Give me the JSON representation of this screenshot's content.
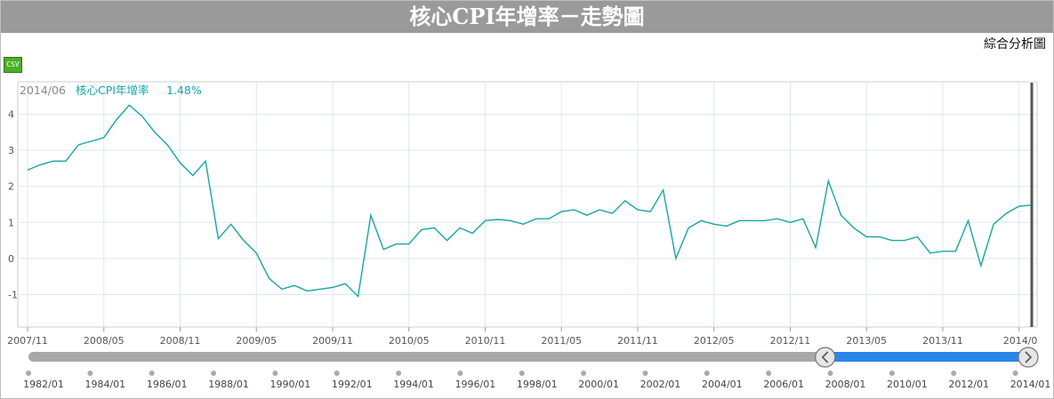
{
  "title": "核心CPI年增率－走勢圖",
  "analysis_link": "綜合分析圖",
  "csv_button": "CSV",
  "legend": {
    "date": "2014/06",
    "series_label": "核心CPI年增率",
    "value": "1.48%"
  },
  "colors": {
    "line": "#17a5a5",
    "navigator_fill": "#2a86e8",
    "navigator_track": "#a8a8a8",
    "title_bg": "#9a9a9a"
  },
  "chart_data": {
    "type": "line",
    "series": [
      {
        "name": "核心CPI年增率",
        "values": [
          2.45,
          2.6,
          2.7,
          2.7,
          3.15,
          3.25,
          3.35,
          3.85,
          4.25,
          3.95,
          3.5,
          3.15,
          2.65,
          2.3,
          2.7,
          0.55,
          0.95,
          0.5,
          0.15,
          -0.55,
          -0.85,
          -0.75,
          -0.9,
          -0.85,
          -0.8,
          -0.7,
          -1.05,
          1.2,
          0.25,
          0.4,
          0.4,
          0.8,
          0.85,
          0.5,
          0.85,
          0.7,
          1.05,
          1.08,
          1.05,
          0.95,
          1.1,
          1.1,
          1.3,
          1.35,
          1.2,
          1.35,
          1.25,
          1.6,
          1.35,
          1.3,
          1.9,
          0.0,
          0.85,
          1.05,
          0.95,
          0.9,
          1.05,
          1.05,
          1.05,
          1.1,
          1.0,
          1.1,
          0.3,
          2.15,
          1.2,
          0.85,
          0.6,
          0.6,
          0.5,
          0.5,
          0.6,
          0.15,
          0.2,
          0.2,
          1.05,
          -0.2,
          0.95,
          1.25,
          1.45,
          1.48
        ]
      }
    ],
    "x_start": "2007/11",
    "x_end": "2014/06",
    "x_tick_labels": [
      "2007/11",
      "2008/05",
      "2008/11",
      "2009/05",
      "2009/11",
      "2010/05",
      "2010/11",
      "2011/05",
      "2011/11",
      "2012/05",
      "2012/11",
      "2013/05",
      "2013/11",
      "2014/0"
    ],
    "y_ticks": [
      4,
      3,
      2,
      1,
      0,
      -1
    ],
    "ylim": [
      -1.9,
      4.9
    ],
    "grid": true,
    "legend_position": "top-left"
  },
  "navigator": {
    "tick_labels": [
      "1982/01",
      "1984/01",
      "1986/01",
      "1988/01",
      "1990/01",
      "1992/01",
      "1994/01",
      "1996/01",
      "1998/01",
      "2000/01",
      "2002/01",
      "2004/01",
      "2006/01",
      "2008/01",
      "2010/01",
      "2012/01",
      "2014/01"
    ],
    "range_start": "2007/11",
    "range_end": "2014/06",
    "full_start": "1982/01",
    "full_end": "2014/06",
    "left_handle_icon": "chevron-left-icon",
    "right_handle_icon": "chevron-right-icon"
  }
}
